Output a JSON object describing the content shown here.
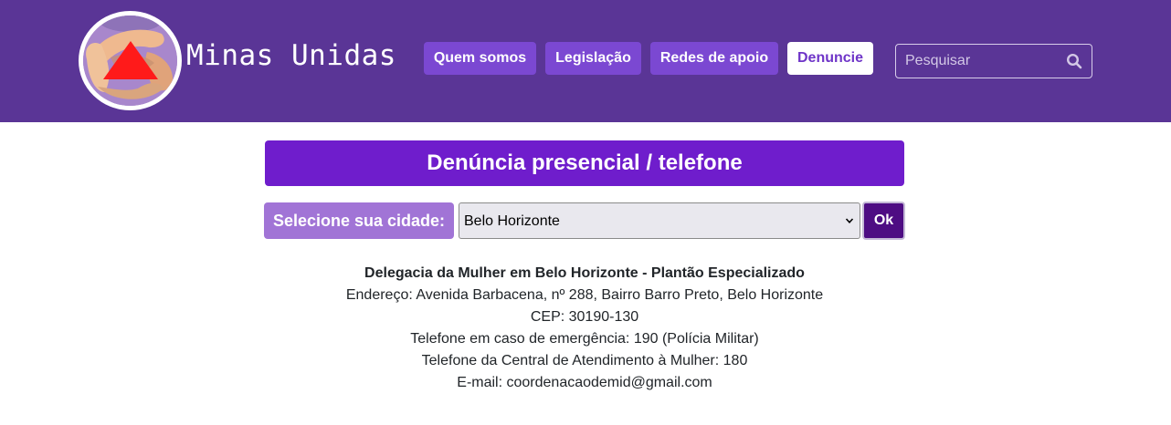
{
  "header": {
    "brand": "Minas Unidas",
    "nav": [
      {
        "label": "Quem somos"
      },
      {
        "label": "Legislação"
      },
      {
        "label": "Redes de apoio"
      },
      {
        "label": "Denuncie",
        "active": true
      }
    ],
    "search": {
      "placeholder": "Pesquisar",
      "icon": "search-icon"
    }
  },
  "main": {
    "title": "Denúncia presencial / telefone",
    "city_label": "Selecione sua cidade:",
    "city_selected": "Belo Horizonte",
    "ok_label": "Ok",
    "info": {
      "title": "Delegacia da Mulher em Belo Horizonte - Plantão Especializado",
      "address": "Endereço: Avenida Barbacena, nº 288, Bairro Barro Preto, Belo Horizonte",
      "cep": "CEP: 30190-130",
      "emergency_phone": "Telefone em caso de emergência: 190 (Polícia Militar)",
      "central_phone": "Telefone da Central de Atendimento à Mulher: 180",
      "email": "E-mail: coordenacaodemid@gmail.com"
    }
  },
  "colors": {
    "navbar": "#5a3596",
    "nav_button": "#7b48d2",
    "title_bar": "#6f1dcc",
    "city_label": "#a174d6",
    "ok_button": "#4e0d83",
    "logo_triangle": "#ff1a1a"
  }
}
